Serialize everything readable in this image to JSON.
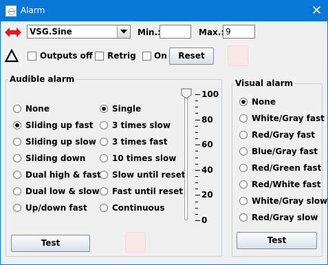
{
  "window": {
    "title": "Alarm",
    "close_glyph": "✕"
  },
  "source": {
    "selected": "VSG.Sine"
  },
  "range": {
    "min_label": "Min.:",
    "min_value": "",
    "max_label": "Max.:",
    "max_value": "9"
  },
  "options": {
    "outputs_off": "Outputs off",
    "retrig": "Retrig",
    "on": "On",
    "reset": "Reset"
  },
  "audible": {
    "title": "Audible alarm",
    "sounds": [
      {
        "label": "None",
        "selected": false
      },
      {
        "label": "Sliding up fast",
        "selected": true
      },
      {
        "label": "Sliding up slow",
        "selected": false
      },
      {
        "label": "Sliding down",
        "selected": false
      },
      {
        "label": "Dual high & fast",
        "selected": false
      },
      {
        "label": "Dual low & slow",
        "selected": false
      },
      {
        "label": "Up/down fast",
        "selected": false
      }
    ],
    "repeats": [
      {
        "label": "Single",
        "selected": true
      },
      {
        "label": "3 times slow",
        "selected": false
      },
      {
        "label": "3 times fast",
        "selected": false
      },
      {
        "label": "10 times slow",
        "selected": false
      },
      {
        "label": "Slow until reset",
        "selected": false
      },
      {
        "label": "Fast until reset",
        "selected": false
      },
      {
        "label": "Continuous",
        "selected": false
      }
    ],
    "volume": {
      "value": 100,
      "ticks": [
        "100",
        "80",
        "60",
        "40",
        "20",
        "0"
      ]
    },
    "test": "Test"
  },
  "visual": {
    "title": "Visual alarm",
    "options": [
      {
        "label": "None",
        "selected": true
      },
      {
        "label": "White/Gray fast",
        "selected": false
      },
      {
        "label": "Red/Gray fast",
        "selected": false
      },
      {
        "label": "Blue/Gray fast",
        "selected": false
      },
      {
        "label": "Red/Green fast",
        "selected": false
      },
      {
        "label": "Red/White fast",
        "selected": false
      },
      {
        "label": "White/Gray slow",
        "selected": false
      },
      {
        "label": "Red/Gray slow",
        "selected": false
      }
    ],
    "test": "Test"
  },
  "colors": {
    "titlebar": "#0a78d7",
    "swap_icon": "#e8161b",
    "indicator": "#f8e8e8"
  },
  "icons": {
    "app": "window-app-icon",
    "swap": "red-double-arrow-icon",
    "delta": "delta-triangle-icon",
    "thumb": "slider-thumb-icon"
  }
}
